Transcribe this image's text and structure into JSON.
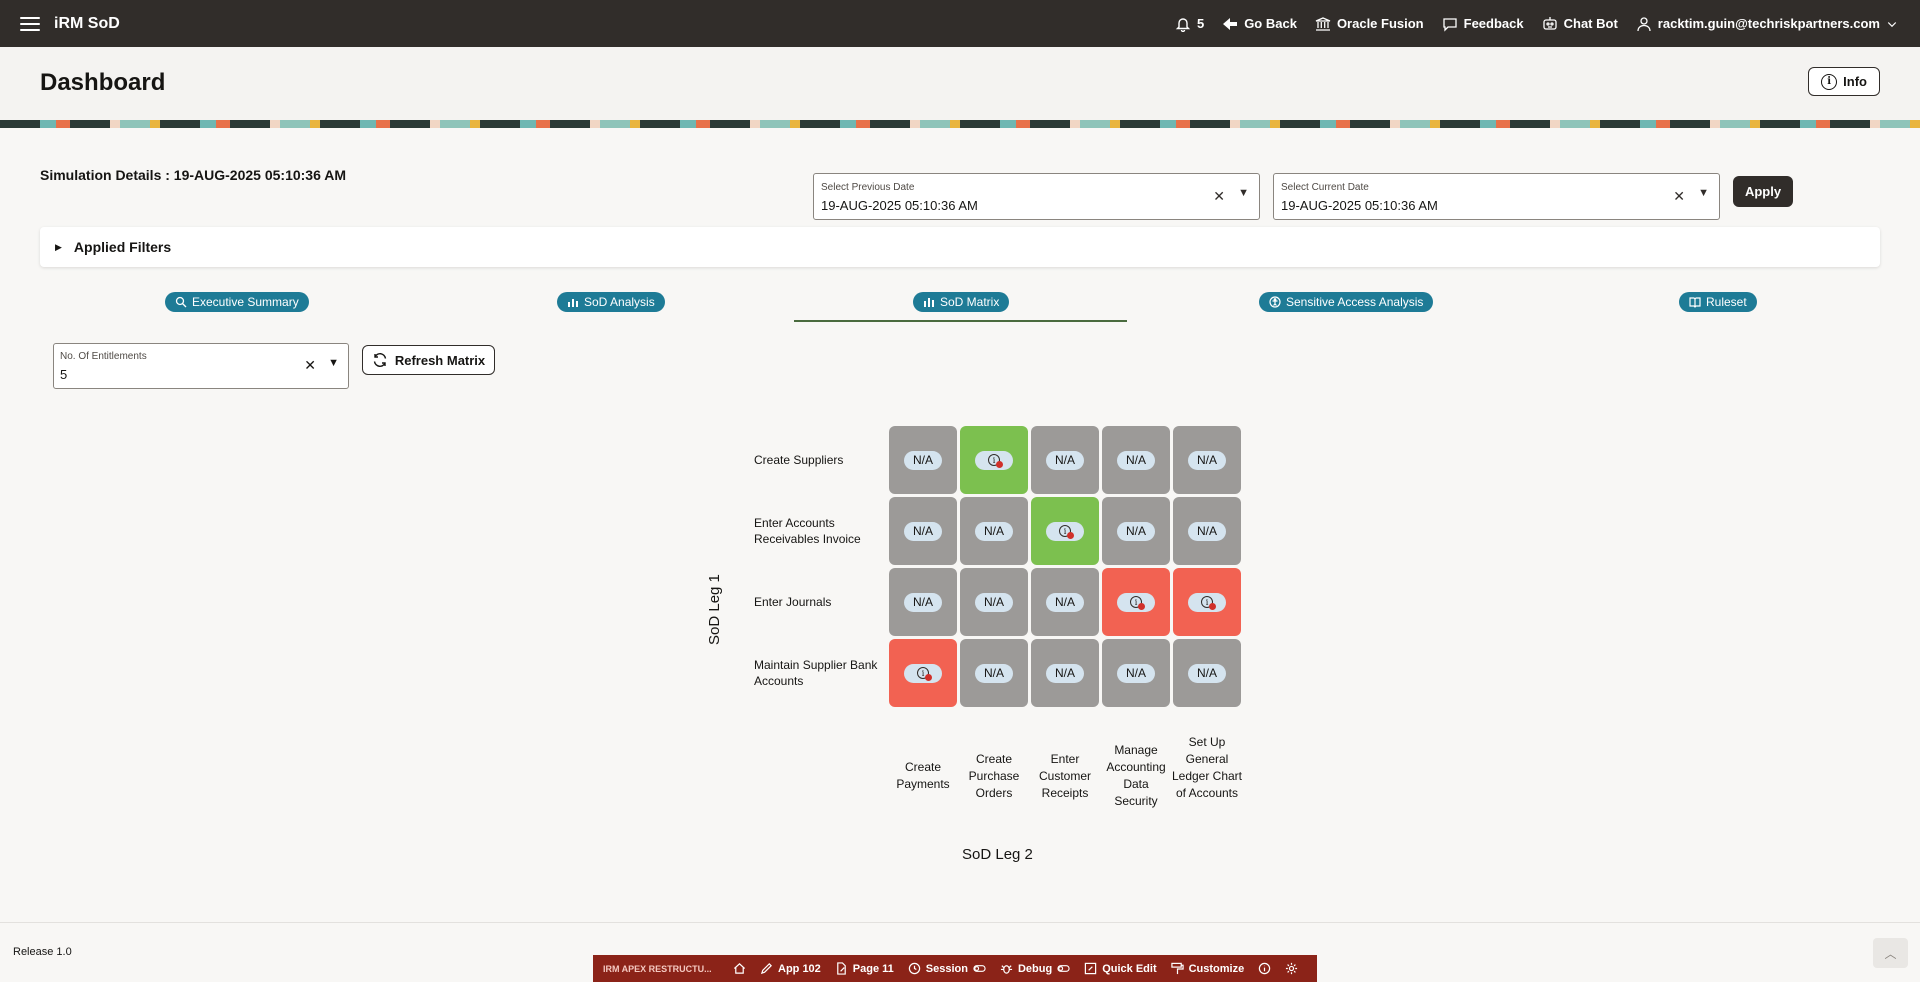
{
  "header": {
    "app_title": "iRM SoD",
    "notification_count": "5",
    "go_back": "Go Back",
    "oracle_fusion": "Oracle Fusion",
    "feedback": "Feedback",
    "chat_bot": "Chat Bot",
    "user": "racktim.guin@techriskpartners.com"
  },
  "page": {
    "title": "Dashboard",
    "info_label": "Info"
  },
  "simulation": {
    "details": "Simulation Details : 19-AUG-2025 05:10:36 AM",
    "previous_date_label": "Select Previous Date",
    "previous_date_value": "19-AUG-2025 05:10:36 AM",
    "current_date_label": "Select Current Date",
    "current_date_value": "19-AUG-2025 05:10:36 AM",
    "apply_label": "Apply"
  },
  "filters": {
    "label": "Applied Filters"
  },
  "tabs": [
    {
      "label": "Executive Summary",
      "icon": "search-chart-icon"
    },
    {
      "label": "SoD Analysis",
      "icon": "bar-chart-icon"
    },
    {
      "label": "SoD Matrix",
      "icon": "bar-chart-icon",
      "active": true
    },
    {
      "label": "Sensitive Access Analysis",
      "icon": "accessibility-icon"
    },
    {
      "label": "Ruleset",
      "icon": "book-icon"
    }
  ],
  "entitlements": {
    "label": "No. Of Entitlements",
    "value": "5",
    "refresh_label": "Refresh Matrix"
  },
  "matrix": {
    "y_axis_label": "SoD Leg 1",
    "x_axis_label": "SoD Leg 2",
    "rows": [
      "Create Suppliers",
      "Enter Accounts Receivables Invoice",
      "Enter Journals",
      "Maintain Supplier Bank Accounts"
    ],
    "columns": [
      "Create Payments",
      "Create Purchase Orders",
      "Enter Customer Receipts",
      "Manage Accounting Data Security",
      "Set Up General Ledger Chart of Accounts"
    ],
    "na_text": "N/A",
    "cells": [
      [
        "na",
        "green",
        "na",
        "na",
        "na"
      ],
      [
        "na",
        "na",
        "green",
        "na",
        "na"
      ],
      [
        "na",
        "na",
        "na",
        "red",
        "red"
      ],
      [
        "red",
        "na",
        "na",
        "na",
        "na"
      ]
    ],
    "colors": {
      "na": "#9c9a98",
      "green": "#7cc04f",
      "red": "#f26252"
    }
  },
  "footer": {
    "release": "Release 1.0"
  },
  "devbar": {
    "app_name": "IRM APEX RESTRUCTU...",
    "app": "App 102",
    "page": "Page 11",
    "session": "Session",
    "debug": "Debug",
    "quick_edit": "Quick Edit",
    "customize": "Customize"
  }
}
